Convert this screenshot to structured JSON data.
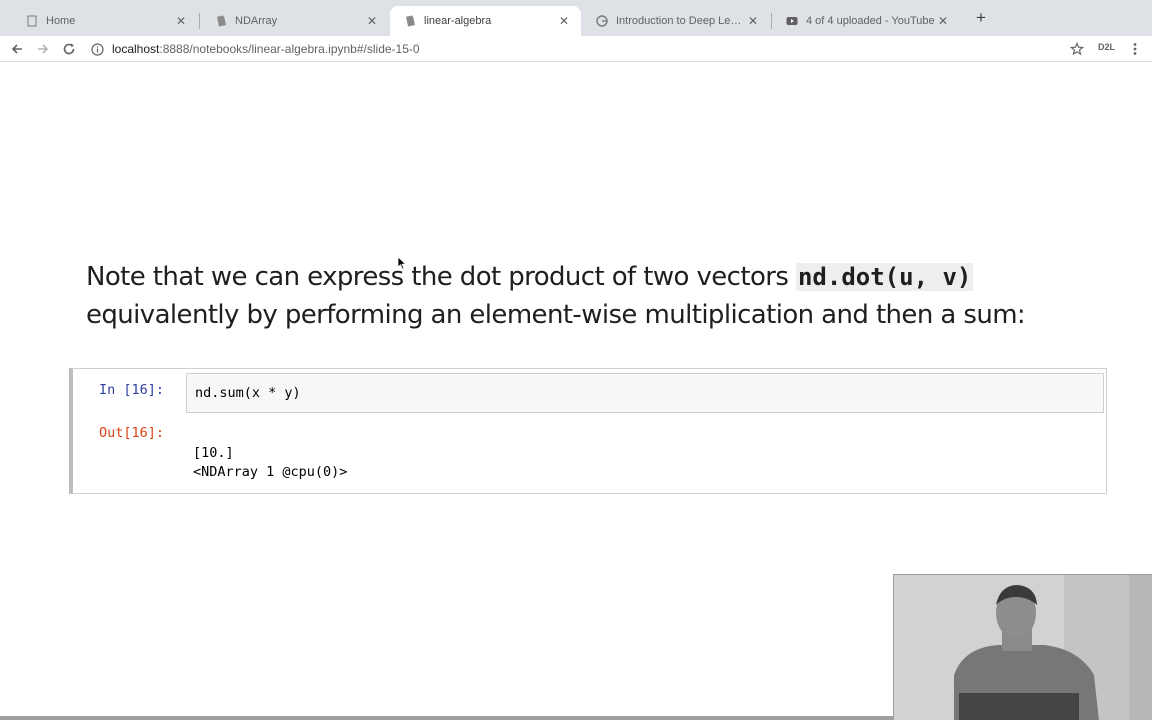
{
  "browser": {
    "tabs": [
      {
        "title": "Home",
        "icon": "jupyter-page-icon",
        "active": false
      },
      {
        "title": "NDArray",
        "icon": "notebook-page-icon",
        "active": false
      },
      {
        "title": "linear-algebra",
        "icon": "notebook-page-icon",
        "active": true
      },
      {
        "title": "Introduction to Deep Learning",
        "icon": "globe-icon",
        "active": false
      },
      {
        "title": "4 of 4 uploaded - YouTube",
        "icon": "youtube-icon",
        "active": false
      }
    ],
    "new_tab_label": "+",
    "url_host": "localhost",
    "url_rest": ":8888/notebooks/linear-algebra.ipynb#/slide-15-0",
    "extension_label": "D2L"
  },
  "slide": {
    "text_part1": "Note that we can express the dot product of two vectors ",
    "code_inline": "nd.dot(u, v)",
    "text_part2": " equivalently by performing an element-wise multiplication and then a sum:"
  },
  "cell": {
    "in_prompt": "In [16]:",
    "code": "nd.sum(x * y)",
    "out_prompt": "Out[16]:",
    "output_lines": [
      "[10.]",
      "<NDArray 1 @cpu(0)>"
    ]
  },
  "colors": {
    "tab_strip": "#dee1e6",
    "in_prompt": "#303f9f",
    "out_prompt": "#d84315"
  }
}
